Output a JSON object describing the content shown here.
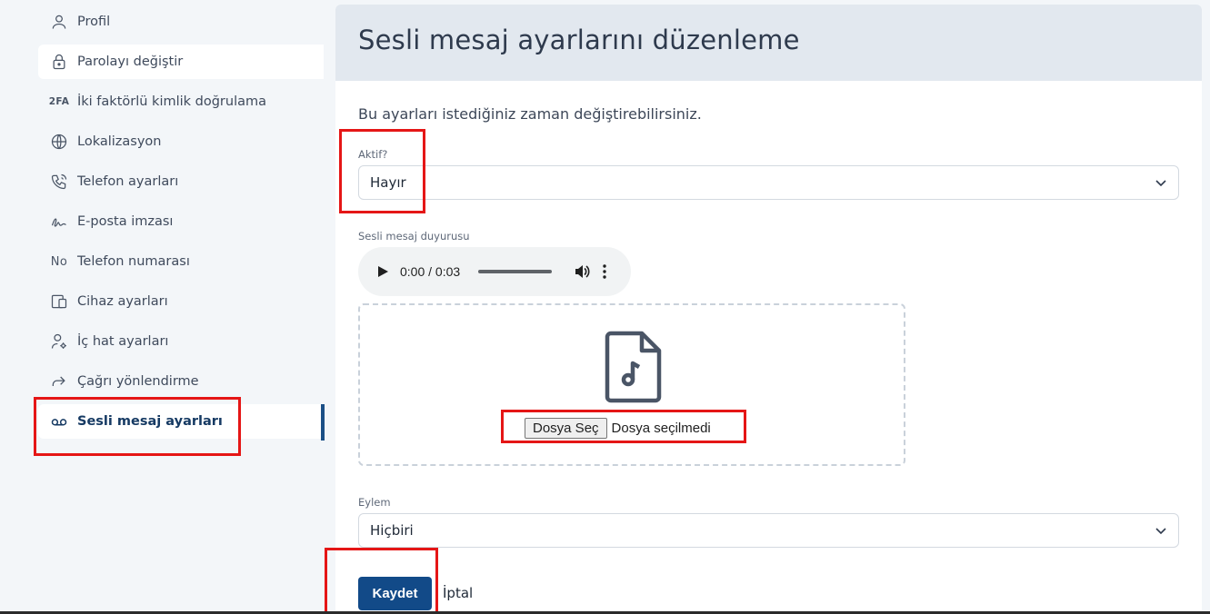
{
  "sidebar": {
    "items": [
      {
        "label": "Profil",
        "icon": "user-icon"
      },
      {
        "label": "Parolayı değiştir",
        "icon": "lock-icon"
      },
      {
        "label": "İki faktörlü kimlik doğrulama",
        "icon": "2FA"
      },
      {
        "label": "Lokalizasyon",
        "icon": "globe-icon"
      },
      {
        "label": "Telefon ayarları",
        "icon": "phone-icon"
      },
      {
        "label": "E-posta imzası",
        "icon": "signature-icon"
      },
      {
        "label": "Telefon numarası",
        "icon": "No"
      },
      {
        "label": "Cihaz ayarları",
        "icon": "devices-icon"
      },
      {
        "label": "İç hat ayarları",
        "icon": "user-settings-icon"
      },
      {
        "label": "Çağrı yönlendirme",
        "icon": "forward-icon"
      },
      {
        "label": "Sesli mesaj ayarları",
        "icon": "voicemail-icon"
      }
    ]
  },
  "main": {
    "title": "Sesli mesaj ayarlarını düzenleme",
    "intro": "Bu ayarları istediğiniz zaman değiştirebilirsiniz.",
    "active": {
      "label": "Aktif?",
      "value": "Hayır"
    },
    "announcement": {
      "label": "Sesli mesaj duyurusu",
      "time": "0:00 / 0:03",
      "file_button": "Dosya Seç",
      "file_status": "Dosya seçilmedi"
    },
    "action": {
      "label": "Eylem",
      "value": "Hiçbiri"
    },
    "save_label": "Kaydet",
    "cancel_label": "İptal"
  },
  "colors": {
    "accent": "#124a88",
    "annotation": "#e51616",
    "header_bg": "#e2e8ef"
  }
}
